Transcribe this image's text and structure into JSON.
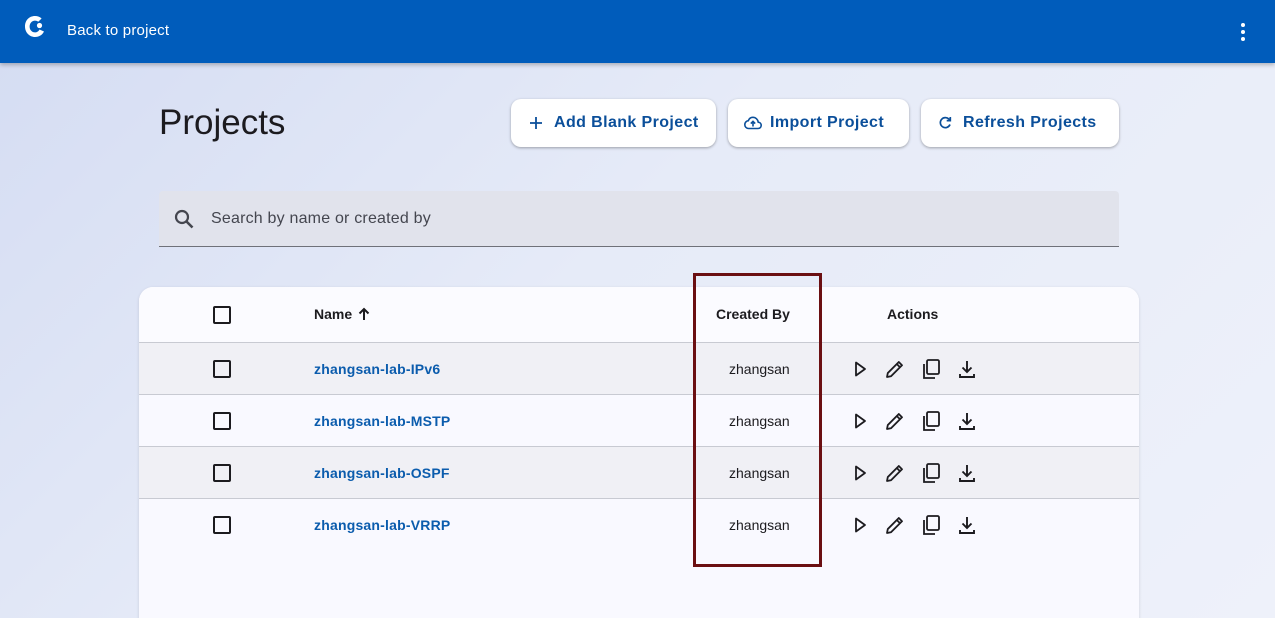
{
  "topbar": {
    "back_label": "Back to project",
    "logo_icon": "app-logo-icon",
    "menu_icon": "more-vertical-icon",
    "color": "#005cbb"
  },
  "page": {
    "title": "Projects"
  },
  "buttons": {
    "add_blank": "Add Blank Project",
    "import": "Import Project",
    "refresh": "Refresh Projects"
  },
  "search": {
    "placeholder": "Search by name or created by",
    "value": ""
  },
  "table": {
    "headers": {
      "name": "Name",
      "created_by": "Created By",
      "actions": "Actions",
      "sort": "ascending"
    },
    "rows": [
      {
        "name": "zhangsan-lab-IPv6",
        "created_by": "zhangsan"
      },
      {
        "name": "zhangsan-lab-MSTP",
        "created_by": "zhangsan"
      },
      {
        "name": "zhangsan-lab-OSPF",
        "created_by": "zhangsan"
      },
      {
        "name": "zhangsan-lab-VRRP",
        "created_by": "zhangsan"
      }
    ],
    "row_actions": [
      "play-icon",
      "edit-icon",
      "copy-icon",
      "download-icon"
    ]
  },
  "colors": {
    "link": "#0b5cad",
    "button_text": "#0b4f9a",
    "highlight": "#6b0f12"
  }
}
